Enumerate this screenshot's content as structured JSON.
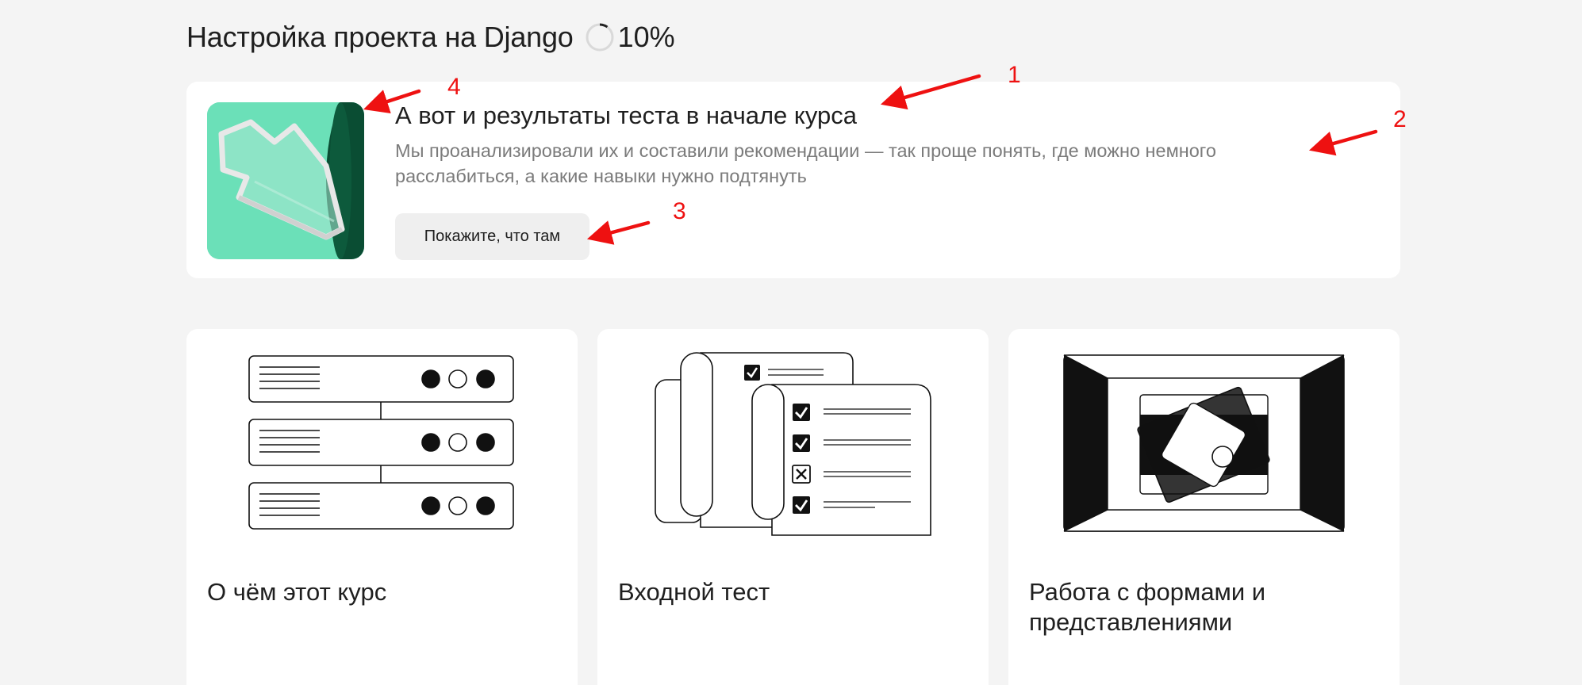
{
  "header": {
    "title": "Настройка проекта на Django",
    "progress_text": "10%",
    "progress_value": 0.1
  },
  "promo": {
    "title": "А вот и результаты теста в начале курса",
    "description": "Мы проанализировали их и составили рекомендации — так проще понять, где можно немного расслабиться, а какие навыки нужно подтянуть",
    "button_label": "Покажите, что там"
  },
  "cards": [
    {
      "title": "О чём этот курс",
      "illustration": "server-rack-icon"
    },
    {
      "title": "Входной тест",
      "illustration": "checklist-icon"
    },
    {
      "title": "Работа с формами и представлениями",
      "illustration": "frames-icon"
    }
  ],
  "annotations": [
    "1",
    "2",
    "3",
    "4"
  ],
  "colors": {
    "background": "#f4f4f4",
    "card": "#ffffff",
    "promo_image": "#6be0b8",
    "annotation": "#ee1111",
    "button": "#efefef"
  }
}
